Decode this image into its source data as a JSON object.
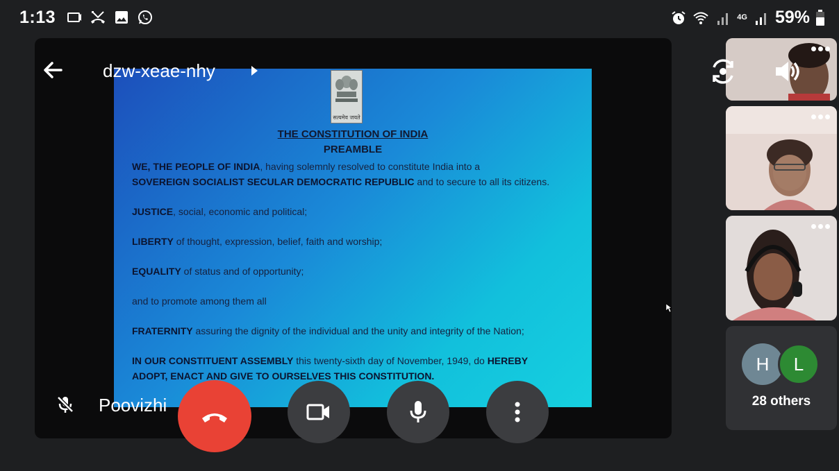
{
  "status_bar": {
    "time": "1:13",
    "battery_percent": "59%",
    "network": "4G"
  },
  "meeting": {
    "code": "dzw-xeae-nhy",
    "self_name": "Poovizhi"
  },
  "slide": {
    "emblem_caption": "सत्यमेव जयते",
    "title": "THE CONSTITUTION OF INDIA",
    "subtitle": "PREAMBLE",
    "paragraphs": [
      {
        "bold": "WE, THE PEOPLE OF INDIA",
        "text": ", having solemnly resolved to constitute India into a"
      },
      {
        "bold": "SOVEREIGN SOCIALIST SECULAR DEMOCRATIC REPUBLIC",
        "text": " and to secure to all its citizens."
      },
      {
        "bold": "JUSTICE",
        "text": ", social, economic and political;"
      },
      {
        "bold": "LIBERTY",
        "text": " of thought, expression, belief, faith and worship;"
      },
      {
        "bold": "EQUALITY",
        "text": " of status and of opportunity;"
      },
      {
        "bold": "",
        "text": "and to promote among them all"
      },
      {
        "bold": "FRATERNITY",
        "text": " assuring the dignity of the individual and the unity and integrity of the Nation;"
      },
      {
        "bold": "IN OUR CONSTITUENT ASSEMBLY",
        "text": " this twenty-sixth day of November, 1949, do "
      },
      {
        "bold": "HEREBY",
        "text": ""
      },
      {
        "bold": "ADOPT, ENACT AND GIVE TO OURSELVES THIS CONSTITUTION.",
        "text": ""
      }
    ]
  },
  "participants": {
    "avatars": [
      "H",
      "L"
    ],
    "others_label": "28 others"
  },
  "colors": {
    "end_call": "#e94235",
    "control_bg": "#3c3d40",
    "avatar_h": "#6f8794",
    "avatar_l": "#2d8a33"
  }
}
